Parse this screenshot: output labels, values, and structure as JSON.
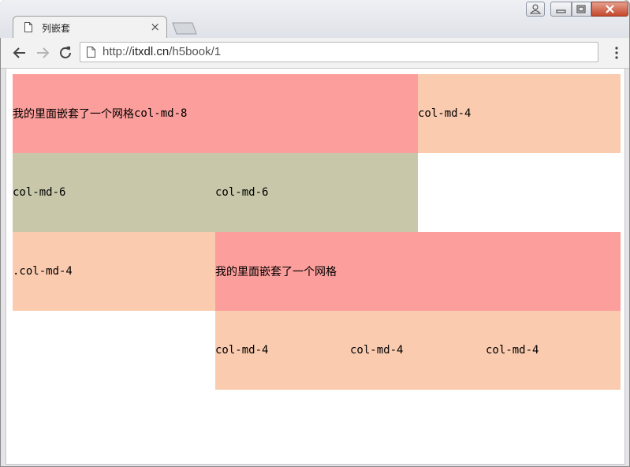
{
  "browser": {
    "tab_title": "列嵌套",
    "tab_close": "×",
    "url_prefix": "http://",
    "url_domain": "itxdl.cn",
    "url_path": "/h5book/1"
  },
  "colors": {
    "pink": "#fc9e9b",
    "peach": "#facbaf",
    "olive": "#c8c7a9"
  },
  "page": {
    "row1": {
      "left_text": "我的里面嵌套了一个网格",
      "left_code": " col-md-8",
      "right": "col-md-4"
    },
    "row2": {
      "a": "col-md-6",
      "b": "col-md-6"
    },
    "row3": {
      "left": ".col-md-4",
      "right": "我的里面嵌套了一个网格"
    },
    "row4": {
      "a": "col-md-4",
      "b": "col-md-4",
      "c": "col-md-4"
    }
  }
}
